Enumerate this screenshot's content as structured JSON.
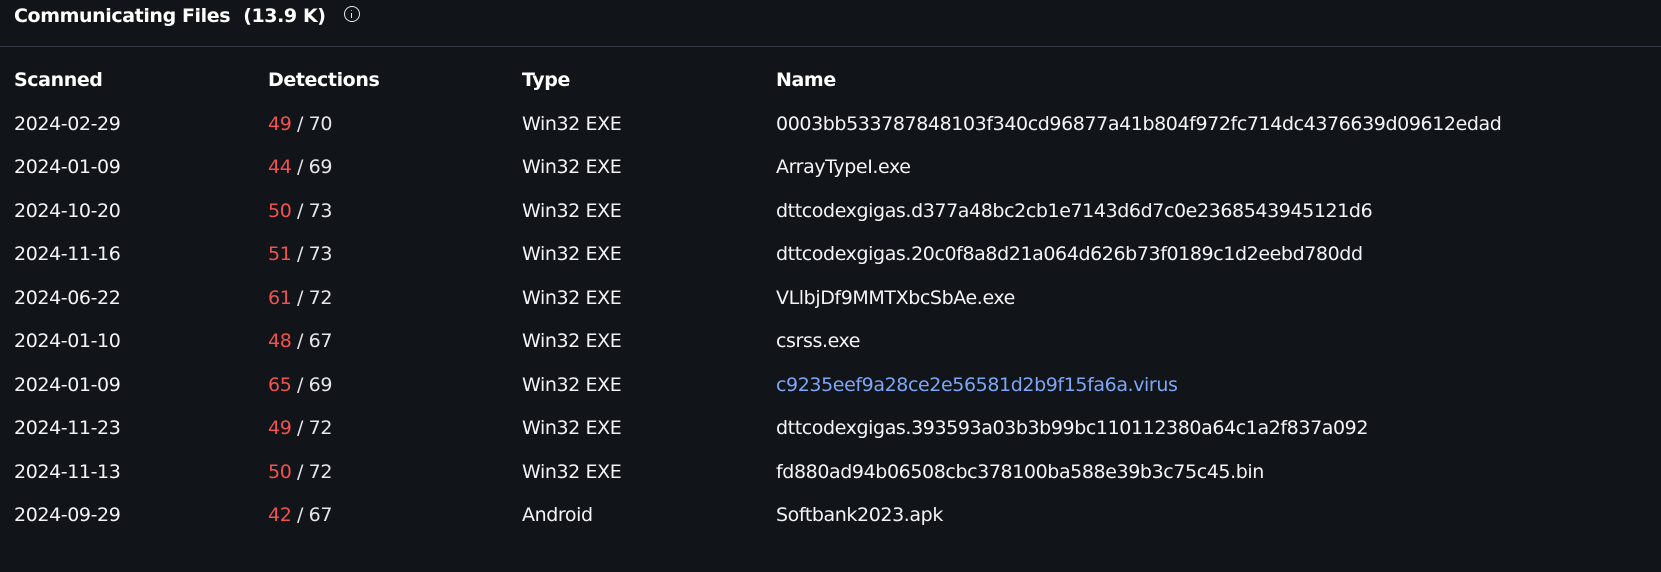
{
  "header": {
    "title": "Communicating Files",
    "count": "(13.9 K)"
  },
  "columns": {
    "scanned": "Scanned",
    "detections": "Detections",
    "type": "Type",
    "name": "Name"
  },
  "rows": [
    {
      "scanned": "2024-02-29",
      "positives": "49",
      "total": "/ 70",
      "type": "Win32 EXE",
      "name": "0003bb533787848103f340cd96877a41b804f972fc714dc4376639d09612edad"
    },
    {
      "scanned": "2024-01-09",
      "positives": "44",
      "total": "/ 69",
      "type": "Win32 EXE",
      "name": "ArrayTypeI.exe"
    },
    {
      "scanned": "2024-10-20",
      "positives": "50",
      "total": "/ 73",
      "type": "Win32 EXE",
      "name": "dttcodexgigas.d377a48bc2cb1e7143d6d7c0e2368543945121d6"
    },
    {
      "scanned": "2024-11-16",
      "positives": "51",
      "total": "/ 73",
      "type": "Win32 EXE",
      "name": "dttcodexgigas.20c0f8a8d21a064d626b73f0189c1d2eebd780dd"
    },
    {
      "scanned": "2024-06-22",
      "positives": "61",
      "total": "/ 72",
      "type": "Win32 EXE",
      "name": "VLlbjDf9MMTXbcSbAe.exe"
    },
    {
      "scanned": "2024-01-10",
      "positives": "48",
      "total": "/ 67",
      "type": "Win32 EXE",
      "name": "csrss.exe"
    },
    {
      "scanned": "2024-01-09",
      "positives": "65",
      "total": "/ 69",
      "type": "Win32 EXE",
      "name": "c9235eef9a28ce2e56581d2b9f15fa6a.virus"
    },
    {
      "scanned": "2024-11-23",
      "positives": "49",
      "total": "/ 72",
      "type": "Win32 EXE",
      "name": "dttcodexgigas.393593a03b3b99bc110112380a64c1a2f837a092"
    },
    {
      "scanned": "2024-11-13",
      "positives": "50",
      "total": "/ 72",
      "type": "Win32 EXE",
      "name": "fd880ad94b06508cbc378100ba588e39b3c75c45.bin"
    },
    {
      "scanned": "2024-09-29",
      "positives": "42",
      "total": "/ 67",
      "type": "Android",
      "name": "Softbank2023.apk"
    }
  ],
  "colors": {
    "background": "#111419",
    "positives": "#f05252",
    "link": "#7ea6f6",
    "divider": "#353b4a"
  },
  "icons": {
    "info": "info-icon"
  }
}
